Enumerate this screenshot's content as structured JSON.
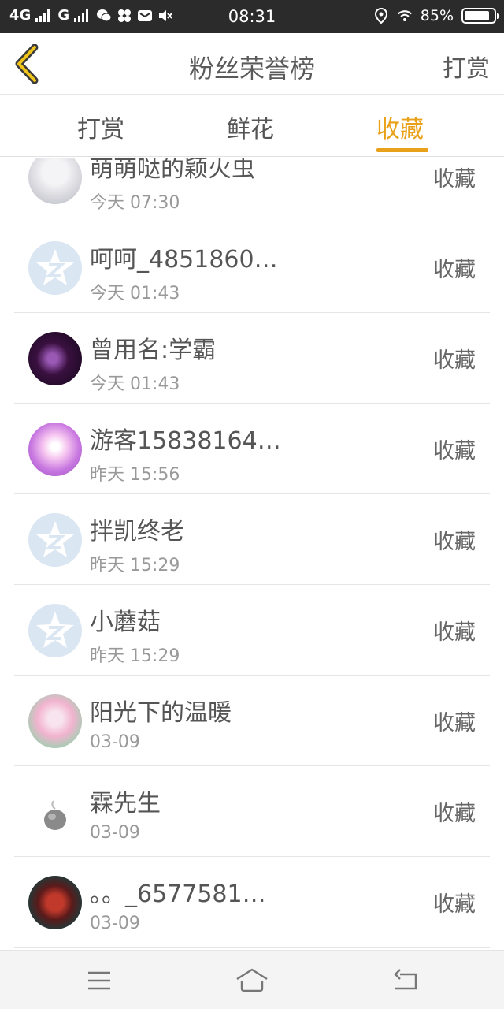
{
  "status_bar": {
    "network_1": "4G",
    "network_2": "G",
    "time": "08:31",
    "battery": "85%",
    "battery_level": 0.85
  },
  "nav": {
    "title": "粉丝荣誉榜",
    "action_label": "打赏",
    "back_icon": "chevron-left-icon"
  },
  "tabs": [
    {
      "label": "打赏",
      "active": false
    },
    {
      "label": "鲜花",
      "active": false
    },
    {
      "label": "收藏",
      "active": true
    }
  ],
  "accent_color": "#e8a118",
  "list": [
    {
      "name": "萌萌哒的颖火虫",
      "time": "今天 07:30",
      "action": "收藏",
      "avatar": "photo"
    },
    {
      "name": "呵呵_4851860…",
      "time": "今天 01:43",
      "action": "收藏",
      "avatar": "default-star"
    },
    {
      "name": "曾用名:学霸",
      "time": "今天 01:43",
      "action": "收藏",
      "avatar": "photo"
    },
    {
      "name": "游客15838164…",
      "time": "昨天 15:56",
      "action": "收藏",
      "avatar": "photo"
    },
    {
      "name": "拌凯终老",
      "time": "昨天 15:29",
      "action": "收藏",
      "avatar": "default-star"
    },
    {
      "name": "小蘑菇",
      "time": "昨天 15:29",
      "action": "收藏",
      "avatar": "default-star"
    },
    {
      "name": "阳光下的温暖",
      "time": "03-09",
      "action": "收藏",
      "avatar": "photo"
    },
    {
      "name": "霖先生",
      "time": "03-09",
      "action": "收藏",
      "avatar": "photo"
    },
    {
      "name": "。。_6577581…",
      "time": "03-09",
      "action": "收藏",
      "avatar": "photo"
    }
  ],
  "bottom_nav": [
    "menu-icon",
    "home-icon",
    "back-icon"
  ]
}
